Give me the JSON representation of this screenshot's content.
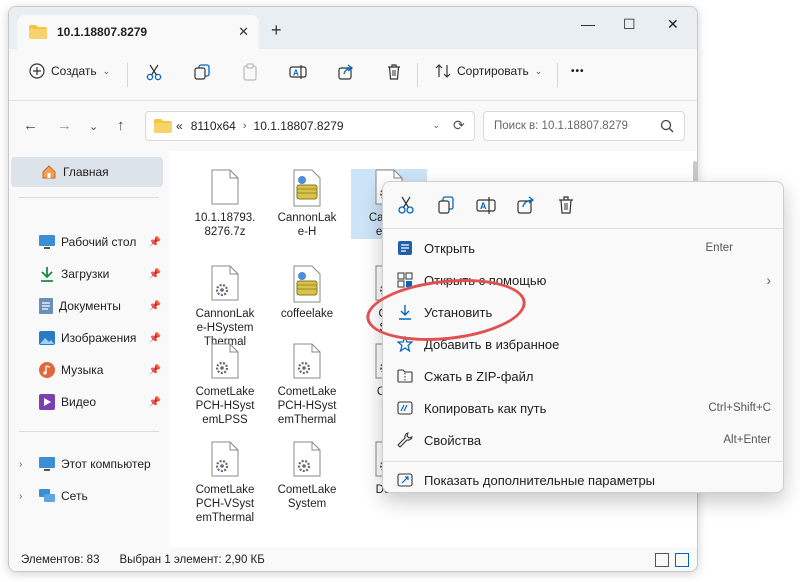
{
  "tab": {
    "title": "10.1.18807.8279",
    "close": "✕",
    "new": "+"
  },
  "window_controls": {
    "minimize": "—",
    "maximize": "☐",
    "close": "✕"
  },
  "toolbar": {
    "create_label": "Создать",
    "sort_label": "Сортировать",
    "more": "•••"
  },
  "address": {
    "crumbs": [
      "«",
      "8110x64",
      "10.1.18807.8279"
    ]
  },
  "search": {
    "placeholder": "Поиск в: 10.1.18807.8279"
  },
  "sidebar": {
    "home": "Главная",
    "items": [
      {
        "label": "Рабочий стол",
        "icon": "desktop-icon"
      },
      {
        "label": "Загрузки",
        "icon": "download-icon"
      },
      {
        "label": "Документы",
        "icon": "documents-icon"
      },
      {
        "label": "Изображения",
        "icon": "pictures-icon"
      },
      {
        "label": "Музыка",
        "icon": "music-icon"
      },
      {
        "label": "Видео",
        "icon": "video-icon"
      }
    ],
    "computer": "Этот компьютер",
    "network": "Сеть"
  },
  "files": [
    {
      "name": "10.1.18793.\n8276.7z",
      "icon": "file"
    },
    {
      "name": "CannonLak\ne-H",
      "icon": "setup"
    },
    {
      "name": "Cannon\ne-HS",
      "icon": "gear"
    },
    {
      "name": "CannonLak\ne-HSystem\nThermal",
      "icon": "gear"
    },
    {
      "name": "coffeelake",
      "icon": "setup"
    },
    {
      "name": "Coff\nSys",
      "icon": "gear"
    },
    {
      "name": "CometLake\nPCH-HSyst\nemLPSS",
      "icon": "gear"
    },
    {
      "name": "CometLake\nPCH-HSyst\nemThermal",
      "icon": "gear"
    },
    {
      "name": "Com\nPC",
      "icon": "gear"
    },
    {
      "name": "CometLake\nPCH-VSyst\nemThermal",
      "icon": "gear"
    },
    {
      "name": "CometLake\nSystem",
      "icon": "gear"
    },
    {
      "name": "Denv",
      "icon": "gear"
    }
  ],
  "status": {
    "count": "Элементов: 83",
    "selected": "Выбран 1 элемент: 2,90 КБ"
  },
  "context_menu": {
    "items": [
      {
        "label": "Открыть",
        "shortcut": "Enter"
      },
      {
        "label": "Открыть с помощью",
        "shortcut": "›"
      },
      {
        "label": "Установить",
        "shortcut": ""
      },
      {
        "label": "Добавить в избранное",
        "shortcut": ""
      },
      {
        "label": "Сжать в ZIP-файл",
        "shortcut": ""
      },
      {
        "label": "Копировать как путь",
        "shortcut": "Ctrl+Shift+C"
      },
      {
        "label": "Свойства",
        "shortcut": "Alt+Enter"
      },
      {
        "label": "Показать дополнительные параметры",
        "shortcut": ""
      }
    ]
  },
  "colors": {
    "accent": "#0067c0",
    "highlight_ring": "#e0504f",
    "selection": "#cce4f7",
    "folder": "#f4c542"
  }
}
